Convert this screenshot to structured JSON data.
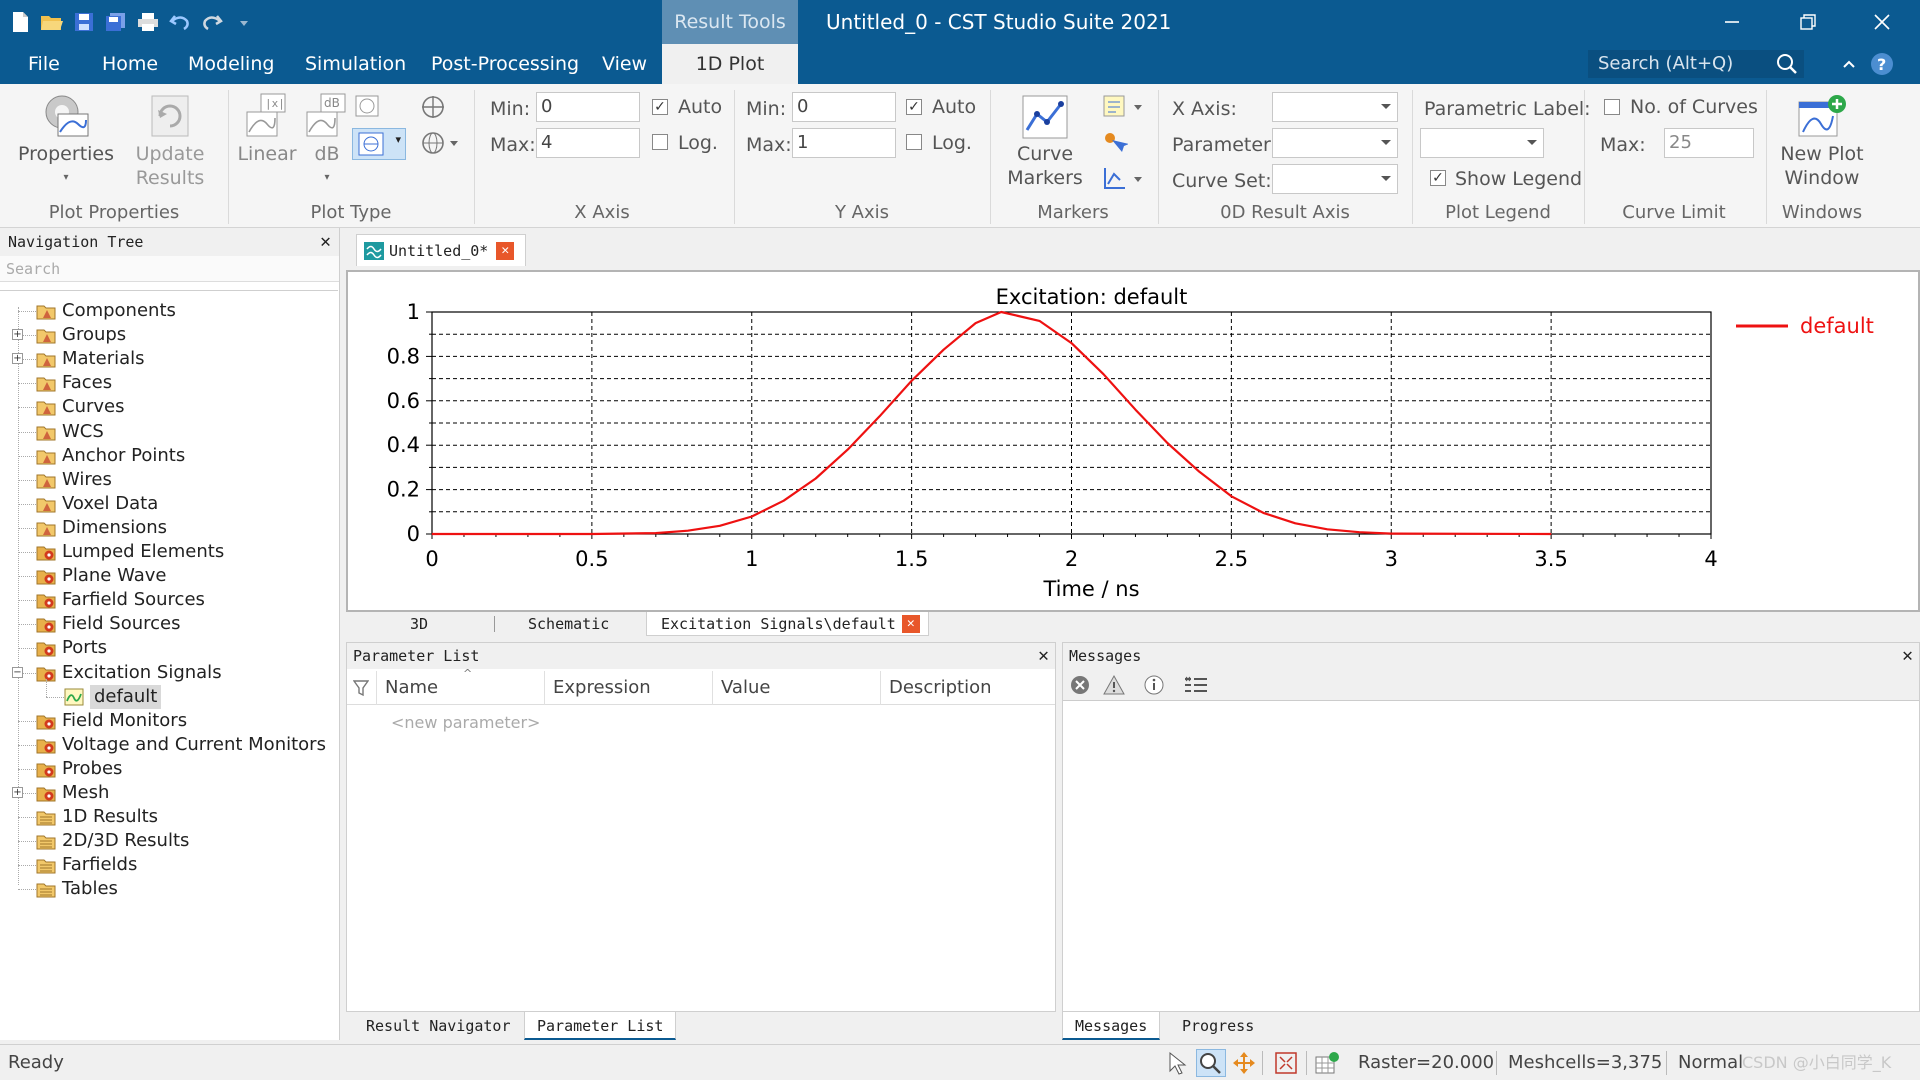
{
  "titlebar": {
    "context_tab": "Result Tools",
    "title": "Untitled_0 - CST Studio Suite 2021"
  },
  "menu": {
    "items": [
      "File",
      "Home",
      "Modeling",
      "Simulation",
      "Post-Processing",
      "View"
    ],
    "active_tab": "1D Plot",
    "search_placeholder": "Search (Alt+Q)"
  },
  "ribbon": {
    "plot_properties": {
      "properties": "Properties",
      "update_results": "Update Results",
      "group": "Plot Properties"
    },
    "plot_type": {
      "linear": "Linear",
      "db": "dB",
      "group": "Plot Type"
    },
    "x_axis": {
      "min_label": "Min:",
      "min_value": "0",
      "max_label": "Max:",
      "max_value": "4",
      "auto_label": "Auto",
      "auto_checked": true,
      "log_label": "Log.",
      "log_checked": false,
      "group": "X Axis"
    },
    "y_axis": {
      "min_label": "Min:",
      "min_value": "0",
      "max_label": "Max:",
      "max_value": "1",
      "auto_label": "Auto",
      "auto_checked": true,
      "log_label": "Log.",
      "log_checked": false,
      "group": "Y Axis"
    },
    "markers": {
      "curve_markers": "Curve Markers",
      "group": "Markers"
    },
    "result_axis": {
      "x_axis": "X Axis:",
      "parameter": "Parameter:",
      "curve_set": "Curve Set:",
      "group": "0D Result Axis"
    },
    "plot_legend": {
      "parametric_label": "Parametric Label:",
      "show_legend": "Show Legend",
      "show_legend_checked": true,
      "group": "Plot Legend"
    },
    "curve_limit": {
      "no_of_curves": "No. of Curves",
      "max_label": "Max:",
      "max_value": "25",
      "group": "Curve Limit"
    },
    "windows": {
      "new_plot_window": "New Plot Window",
      "group": "Windows"
    }
  },
  "nav": {
    "title": "Navigation Tree",
    "search_placeholder": "Search",
    "items": [
      "Components",
      "Groups",
      "Materials",
      "Faces",
      "Curves",
      "WCS",
      "Anchor Points",
      "Wires",
      "Voxel Data",
      "Dimensions",
      "Lumped Elements",
      "Plane Wave",
      "Farfield Sources",
      "Field Sources",
      "Ports",
      "Excitation Signals",
      "default",
      "Field Monitors",
      "Voltage and Current Monitors",
      "Probes",
      "Mesh",
      "1D Results",
      "2D/3D Results",
      "Farfields",
      "Tables"
    ]
  },
  "doc_tab": {
    "label": "Untitled_0*"
  },
  "chart_data": {
    "type": "line",
    "title": "Excitation: default",
    "xlabel": "Time / ns",
    "ylabel": "",
    "xlim": [
      0,
      4
    ],
    "ylim": [
      0,
      1
    ],
    "xticks": [
      "0",
      "0.5",
      "1",
      "1.5",
      "2",
      "2.5",
      "3",
      "3.5",
      "4"
    ],
    "yticks": [
      "0",
      "0.2",
      "0.4",
      "0.6",
      "0.8",
      "1"
    ],
    "grid": true,
    "legend_position": "right",
    "series": [
      {
        "name": "default",
        "color": "#ee1111",
        "x": [
          0,
          0.5,
          0.7,
          0.8,
          0.9,
          1.0,
          1.1,
          1.2,
          1.3,
          1.4,
          1.5,
          1.6,
          1.7,
          1.78,
          1.9,
          2.0,
          2.1,
          2.2,
          2.3,
          2.4,
          2.5,
          2.6,
          2.7,
          2.8,
          2.9,
          3.0,
          3.5
        ],
        "y": [
          0,
          0,
          0.004,
          0.015,
          0.037,
          0.079,
          0.15,
          0.25,
          0.38,
          0.53,
          0.69,
          0.83,
          0.95,
          1.0,
          0.96,
          0.86,
          0.72,
          0.56,
          0.41,
          0.28,
          0.17,
          0.095,
          0.048,
          0.021,
          0.008,
          0.002,
          0
        ]
      }
    ]
  },
  "view_tabs": [
    "3D",
    "Schematic",
    "Excitation Signals\\default"
  ],
  "param": {
    "title": "Parameter List",
    "columns": [
      "Name",
      "Expression",
      "Value",
      "Description"
    ],
    "new_row": "<new parameter>",
    "bottom_tabs": [
      "Result Navigator",
      "Parameter List"
    ]
  },
  "messages": {
    "title": "Messages",
    "bottom_tabs": [
      "Messages",
      "Progress"
    ]
  },
  "status": {
    "ready": "Ready",
    "raster": "Raster=20.000",
    "meshcells": "Meshcells=3,375",
    "normal": "Normal"
  },
  "watermark": "CSDN @小白同学_K"
}
